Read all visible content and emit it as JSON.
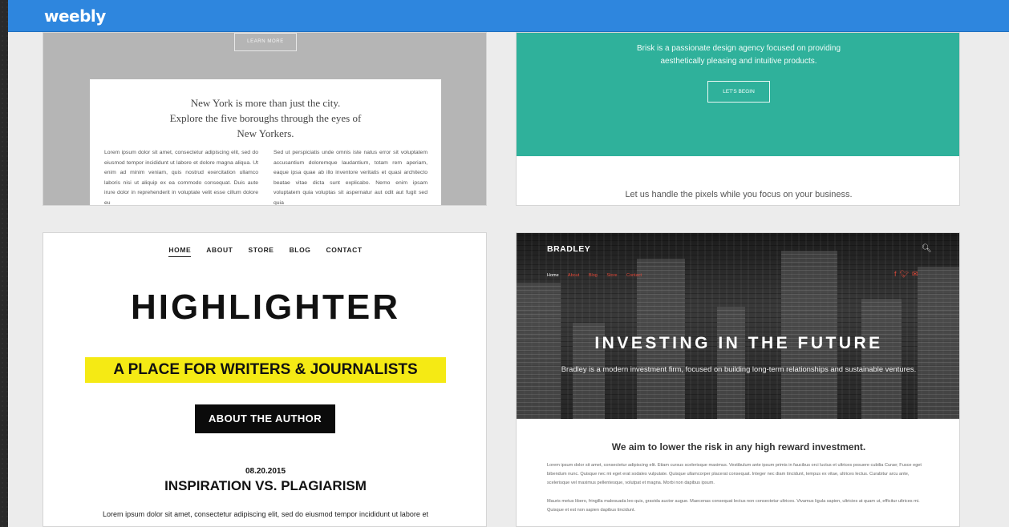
{
  "app": {
    "logo": "weebly",
    "brand_color": "#2e86de"
  },
  "themes": [
    {
      "name": "new-york",
      "learn_more": "LEARN MORE",
      "headline": [
        "New York is more than just the city.",
        "Explore the five boroughs through the eyes of",
        "New Yorkers."
      ],
      "col_left": "Lorem ipsum dolor sit amet, consectetur adipiscing elit, sed do eiusmod tempor incididunt ut labore et dolore magna aliqua. Ut enim ad minim veniam, quis nostrud exercitation ullamco laboris nisi ut aliquip ex ea commodo consequat. Duis aute irure dolor in reprehenderit in voluptate velit esse cillum dolore eu",
      "col_right": "Sed ut perspiciatis unde omnis iste natus error sit voluptatem accusantium doloremque laudantium, totam rem aperiam, eaque ipsa quae ab illo inventore veritatis et quasi architecto beatae vitae dicta sunt explicabo. Nemo enim ipsam voluptatem quia voluptas sit aspernatur aut odit aut fugit sed quia"
    },
    {
      "name": "brisk",
      "intro": [
        "Brisk is a passionate design agency focused on providing",
        "aesthetically pleasing and intuitive products."
      ],
      "cta": "LET'S BEGIN",
      "tagline": "Let us handle the pixels while you focus on your business.",
      "accent": "#2fb19b"
    },
    {
      "name": "highlighter",
      "nav": [
        "HOME",
        "ABOUT",
        "STORE",
        "BLOG",
        "CONTACT"
      ],
      "title": "HIGHLIGHTER",
      "tagline": "A PLACE FOR WRITERS & JOURNALISTS",
      "button": "ABOUT THE AUTHOR",
      "date": "08.20.2015",
      "post_title": "INSPIRATION VS. PLAGIARISM",
      "excerpt": "Lorem ipsum dolor sit amet, consectetur adipiscing elit, sed do eiusmod tempor incididunt ut labore et dolore magna aliqua. Ut enim ad minim veniam, quis",
      "highlight": "#f5ea14"
    },
    {
      "name": "bradley",
      "brand": "BRADLEY",
      "menu": [
        "Home",
        "About",
        "Blog",
        "Store",
        "Contact"
      ],
      "title": "INVESTING IN THE FUTURE",
      "subtitle": "Bradley is a modern investment firm, focused on building long-term relationships and sustainable ventures.",
      "heading": "We aim to lower the risk in any high reward investment.",
      "para1": "Lorem ipsum dolor sit amet, consectetur adipiscing elit. Etiam cursus scelerisque maximus. Vestibulum ante ipsum primis in faucibus orci luctus et ultrices posuere cubilia Curae; Fusce eget bibendum nunc. Quisque nec mi eget erat sodales vulputate. Quisque ullamcorper placerat consequat. Integer nec diam tincidunt, tempus ex vitae, ultrices lectus. Curabitur arcu ante, scelerisque vel maximus pellentesque, volutpat et magna. Morbi non dapibus ipsum.",
      "para2": "Mauris metus libero, fringilla malesuada leo quis, gravida auctor augue. Maecenas consequat lectus non consectetur ultrices. Vivamus ligula sapien, ultricies at quam ut, efficitur ultrices mi. Quisque et est non sapien dapibus tincidunt.",
      "accent": "#e24a3a"
    }
  ]
}
